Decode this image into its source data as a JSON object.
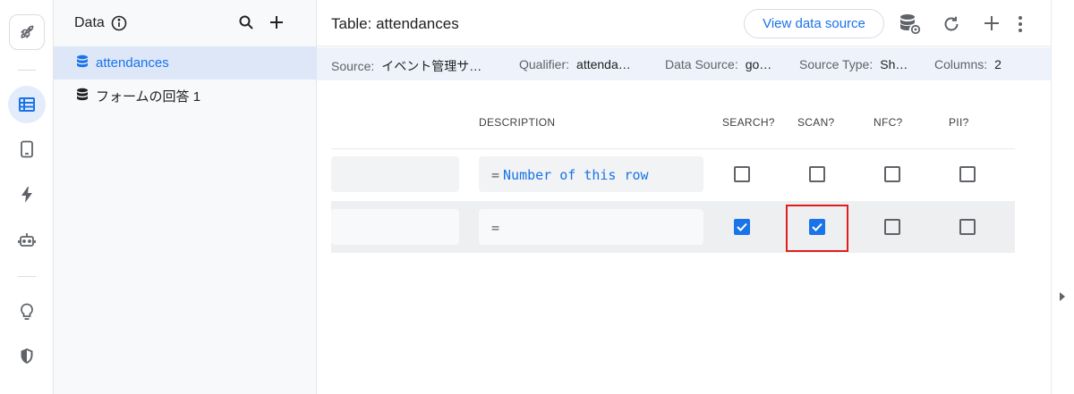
{
  "rail": {
    "items": [
      {
        "name": "rocket-icon"
      },
      {
        "name": "table-icon",
        "active": true
      },
      {
        "name": "phone-icon"
      },
      {
        "name": "bolt-icon"
      },
      {
        "name": "robot-icon"
      },
      {
        "name": "lightbulb-icon"
      },
      {
        "name": "shield-icon"
      }
    ]
  },
  "panel": {
    "title": "Data",
    "items": [
      {
        "label": "attendances",
        "selected": true
      },
      {
        "label": "フォームの回答 1",
        "selected": false
      }
    ]
  },
  "topbar": {
    "title": "Table: attendances",
    "view_button": "View data source"
  },
  "infobar": {
    "source_label": "Source:",
    "source_value": "イベント管理サ…",
    "qualifier_label": "Qualifier:",
    "qualifier_value": "attenda…",
    "datasource_label": "Data Source:",
    "datasource_value": "go…",
    "sourcetype_label": "Source Type:",
    "sourcetype_value": "Sh…",
    "columns_label": "Columns:",
    "columns_value": "2"
  },
  "columns": {
    "description": "DESCRIPTION",
    "search": "SEARCH?",
    "scan": "SCAN?",
    "nfc": "NFC?",
    "pii": "PII?"
  },
  "rows": [
    {
      "eq": "=",
      "description": "Number of this row",
      "search": false,
      "scan": false,
      "nfc": false,
      "pii": false
    },
    {
      "eq": "=",
      "description": "",
      "search": true,
      "scan": true,
      "nfc": false,
      "pii": false
    }
  ],
  "colors": {
    "accent": "#1a73e8",
    "highlight": "#e01e1e",
    "selected_bg": "#dde7f8"
  }
}
